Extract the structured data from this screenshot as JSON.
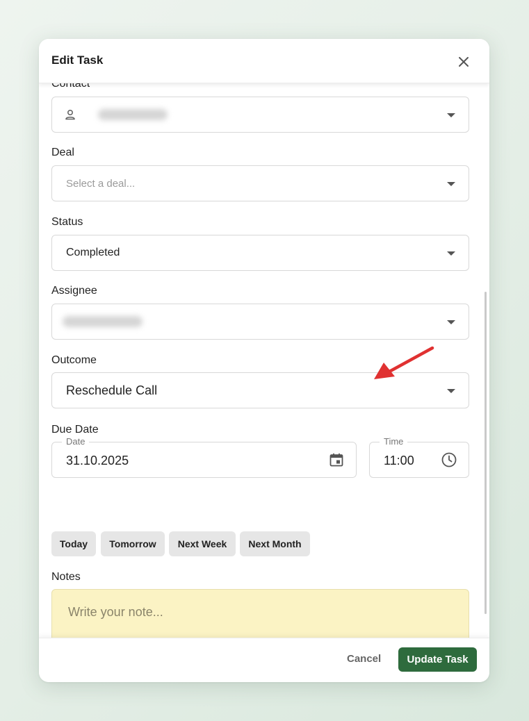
{
  "modal": {
    "title": "Edit Task"
  },
  "fields": {
    "contact": {
      "label": "Contact"
    },
    "deal": {
      "label": "Deal",
      "placeholder": "Select a deal..."
    },
    "status": {
      "label": "Status",
      "value": "Completed"
    },
    "assignee": {
      "label": "Assignee"
    },
    "outcome": {
      "label": "Outcome",
      "value": "Reschedule Call"
    },
    "due_date": {
      "label": "Due Date",
      "date_legend": "Date",
      "date_value": "31.10.2025",
      "time_legend": "Time",
      "time_value": "11:00"
    }
  },
  "quick_dates": [
    "Today",
    "Tomorrow",
    "Next Week",
    "Next Month"
  ],
  "notes": {
    "label": "Notes",
    "placeholder": "Write your note...",
    "toolbar": [
      "bold-icon",
      "italic-icon",
      "underline-icon",
      "highlight-icon",
      "link-icon",
      "numbered-list-icon",
      "bullet-list-icon",
      "text-format-icon"
    ],
    "background": "#fbf3c4"
  },
  "footer": {
    "cancel_label": "Cancel",
    "submit_label": "Update Task"
  },
  "colors": {
    "primary": "#2e6b3d",
    "annotation_arrow": "#e03131"
  }
}
